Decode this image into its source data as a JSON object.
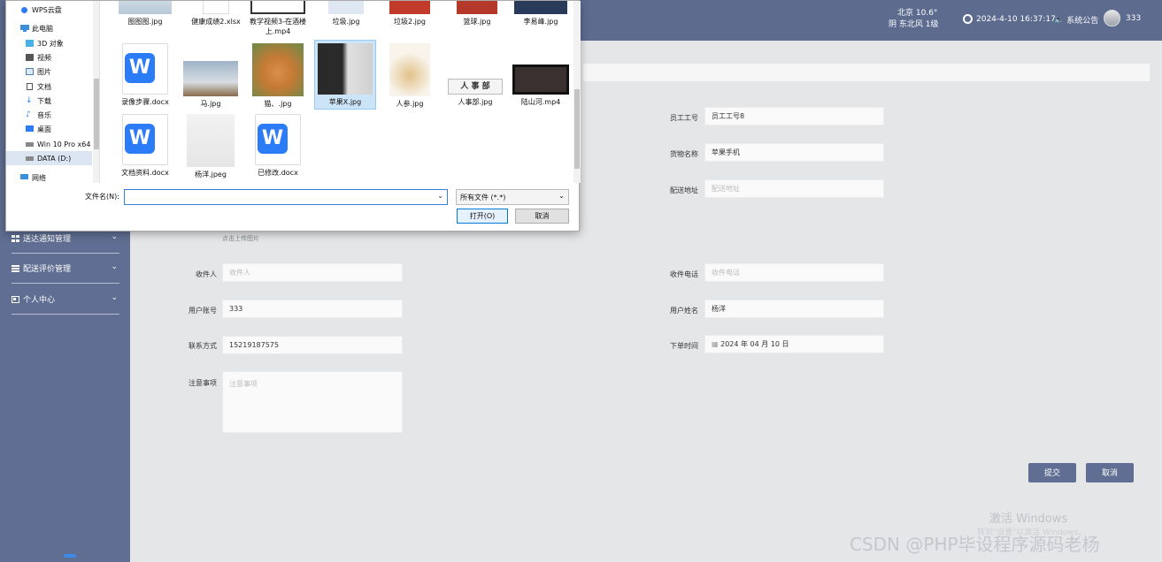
{
  "topbar": {
    "weather_city": "北京",
    "weather_temp": "10.6°",
    "weather_desc": "阴 东北风 1级",
    "datetime": "2024-4-10 16:37:17",
    "notice_label": "系统公告",
    "username": "333"
  },
  "sidebar": {
    "items": [
      {
        "label": "送达通知管理",
        "icon": "grid-icon"
      },
      {
        "label": "配送评价管理",
        "icon": "list-icon"
      },
      {
        "label": "个人中心",
        "icon": "user-card-icon"
      }
    ]
  },
  "form": {
    "fields": {
      "employee_id": {
        "label": "员工工号",
        "value": "员工工号8"
      },
      "goods_name": {
        "label": "货物名称",
        "value": "苹果手机"
      },
      "delivery_address": {
        "label": "配送地址",
        "placeholder": "配送地址"
      },
      "upload_hint": "点击上传图片",
      "recipient": {
        "label": "收件人",
        "placeholder": "收件人"
      },
      "recipient_phone": {
        "label": "收件电话",
        "placeholder": "收件电话"
      },
      "account": {
        "label": "用户账号",
        "value": "333"
      },
      "user_name": {
        "label": "用户姓名",
        "value": "杨洋"
      },
      "contact": {
        "label": "联系方式",
        "value": "15219187575"
      },
      "order_time": {
        "label": "下单时间",
        "value": "2024 年 04 月 10 日"
      },
      "notes": {
        "label": "注意事项",
        "placeholder": "注意事项"
      }
    },
    "submit_label": "提交",
    "cancel_label": "取消"
  },
  "dialog": {
    "nav": [
      {
        "label": "WPS云盘",
        "icon": "cloud-icon"
      },
      {
        "label": "此电脑",
        "icon": "computer-icon"
      },
      {
        "label": "3D 对象",
        "icon": "cube-icon"
      },
      {
        "label": "视频",
        "icon": "video-icon"
      },
      {
        "label": "图片",
        "icon": "image-icon"
      },
      {
        "label": "文档",
        "icon": "document-icon"
      },
      {
        "label": "下载",
        "icon": "download-icon"
      },
      {
        "label": "音乐",
        "icon": "music-icon"
      },
      {
        "label": "桌面",
        "icon": "desktop-icon"
      },
      {
        "label": "Win 10 Pro x64",
        "icon": "drive-icon"
      },
      {
        "label": "DATA (D:)",
        "icon": "drive-icon"
      },
      {
        "label": "网络",
        "icon": "network-icon"
      }
    ],
    "files_row1": [
      "图图图.jpg",
      "健康成绩2.xlsx",
      "教学视频3-在酒楼上.mp4",
      "垃圾.jpg",
      "垃圾2.jpg",
      "篮球.jpg",
      "李易峰.jpg"
    ],
    "files_row2": [
      "录像步骤.docx",
      "马.jpg",
      "猫、.jpg",
      "苹果X.jpg",
      "人参.jpg",
      "人事部.jpg",
      "陆山河.mp4"
    ],
    "files_row3": [
      "文档资料.docx",
      "杨洋.jpeg",
      "已修改.docx"
    ],
    "renshibu_text": "人 事 部",
    "filename_label": "文件名(N):",
    "filename_value": "",
    "filter_value": "所有文件 (*.*)",
    "open_label": "打开(O)",
    "cancel_label": "取消"
  },
  "watermarks": {
    "activate": "激活 Windows",
    "activate_sub": "转到\"设置\"以激活 Windows。",
    "csdn": "CSDN @PHP毕设程序源码老杨"
  }
}
